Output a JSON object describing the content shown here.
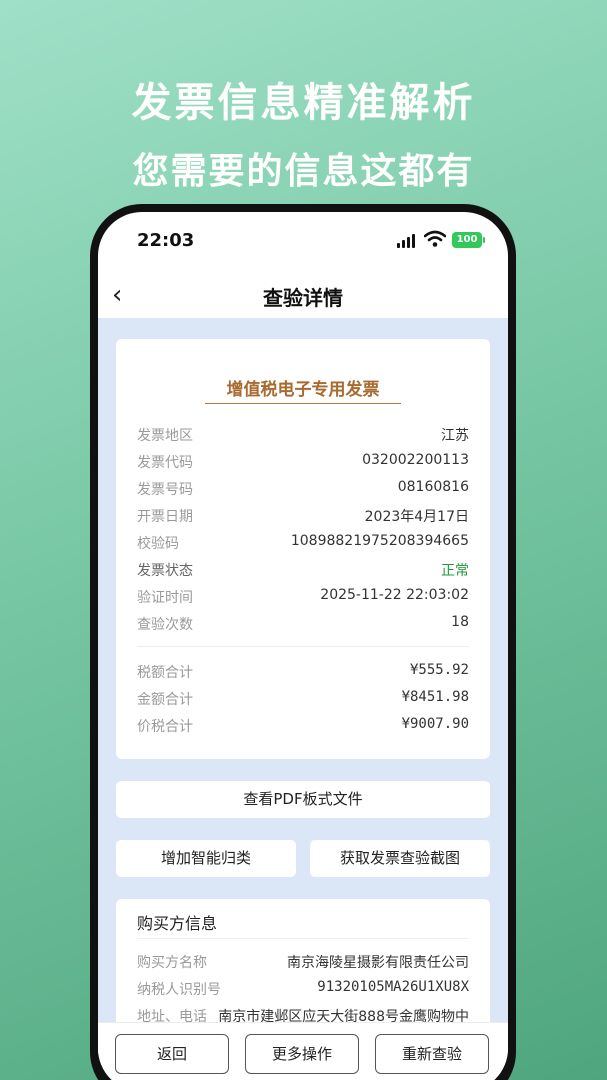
{
  "promo": {
    "headline": "发票信息精准解析",
    "subheadline": "您需要的信息这都有"
  },
  "status_bar": {
    "time": "22:03",
    "battery": "100"
  },
  "nav": {
    "title": "查验详情",
    "back_icon": "chevron-left-icon"
  },
  "invoice": {
    "title": "增值税电子专用发票",
    "fields": [
      {
        "label": "发票地区",
        "value": "江苏"
      },
      {
        "label": "发票代码",
        "value": "032002200113"
      },
      {
        "label": "发票号码",
        "value": "08160816"
      },
      {
        "label": "开票日期",
        "value": "2023年4月17日"
      },
      {
        "label": "校验码",
        "value": "10898821975208394665"
      },
      {
        "label": "发票状态",
        "value": "正常"
      },
      {
        "label": "验证时间",
        "value": "2025-11-22 22:03:02"
      },
      {
        "label": "查验次数",
        "value": "18"
      }
    ],
    "amounts": [
      {
        "label": "税额合计",
        "value": "¥555.92"
      },
      {
        "label": "金额合计",
        "value": "¥8451.98"
      },
      {
        "label": "价税合计",
        "value": "¥9007.90"
      }
    ],
    "status_color": "#1f9b3a"
  },
  "actions": {
    "view_pdf": "查看PDF板式文件",
    "add_classification": "增加智能归类",
    "get_screenshot": "获取发票查验截图"
  },
  "buyer": {
    "title": "购买方信息",
    "fields": [
      {
        "label": "购买方名称",
        "value": "南京海陵星摄影有限责任公司"
      },
      {
        "label": "纳税人识别号",
        "value": "91320105MA26U1XU8X"
      },
      {
        "label": "地址、电话",
        "value": "南京市建邺区应天大街888号金鹰购物中"
      }
    ]
  },
  "bottom": {
    "back": "返回",
    "more": "更多操作",
    "recheck": "重新查验"
  }
}
